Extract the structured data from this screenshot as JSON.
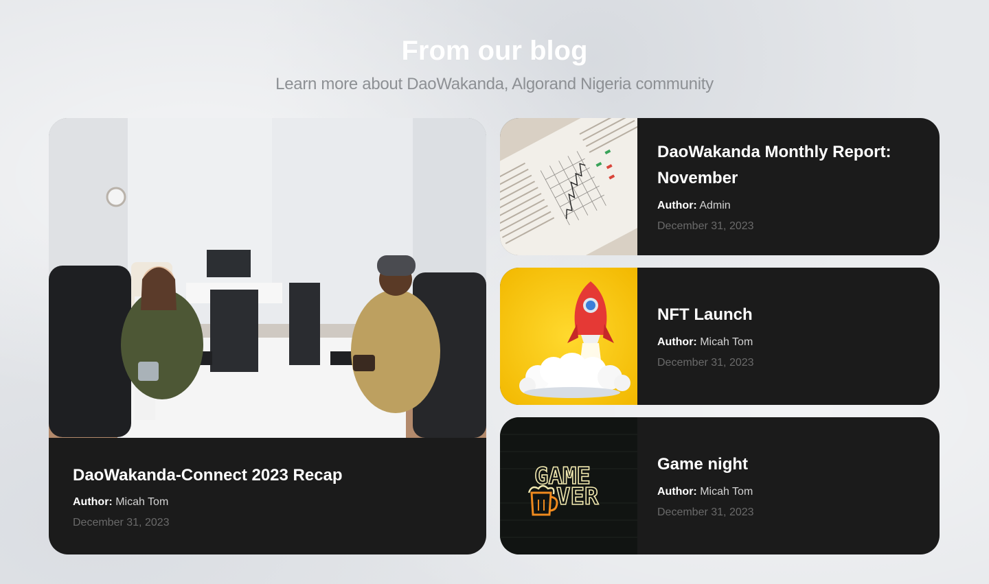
{
  "header": {
    "title": "From our blog",
    "subtitle": "Learn more about DaoWakanda, Algorand Nigeria community"
  },
  "author_label": "Author:",
  "posts": [
    {
      "title": "DaoWakanda-Connect 2023 Recap",
      "author": "Micah Tom",
      "date": "December 31, 2023"
    },
    {
      "title": "DaoWakanda Monthly Report: November",
      "author": "Admin",
      "date": "December 31, 2023"
    },
    {
      "title": "NFT Launch",
      "author": "Micah Tom",
      "date": "December 31, 2023"
    },
    {
      "title": "Game night",
      "author": "Micah Tom",
      "date": "December 31, 2023"
    }
  ],
  "thumbnails": {
    "game_over_text_1": "GAME",
    "game_over_text_2": "VER"
  },
  "colors": {
    "card_bg": "#1b1b1b",
    "title": "#ffffff",
    "subtitle": "#8d9094",
    "date": "#6a6a6a",
    "rocket_bg": "#f5c400"
  }
}
